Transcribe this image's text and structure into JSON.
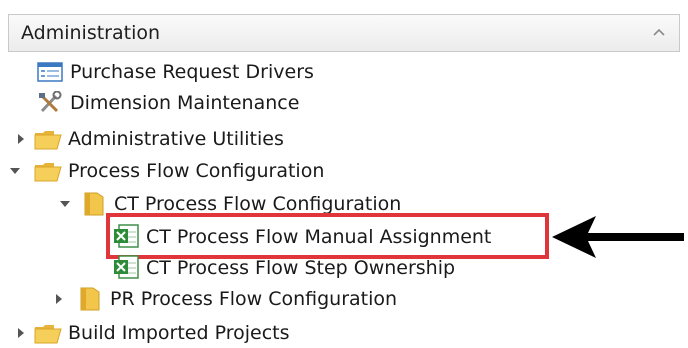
{
  "panel": {
    "title": "Administration"
  },
  "tree": {
    "purchase_request_drivers": "Purchase Request Drivers",
    "dimension_maintenance": "Dimension Maintenance",
    "administrative_utilities": "Administrative Utilities",
    "process_flow_configuration": "Process Flow Configuration",
    "ct_process_flow_configuration": "CT Process Flow Configuration",
    "ct_process_flow_manual_assignment": "CT Process Flow Manual Assignment",
    "ct_process_flow_step_ownership": "CT Process Flow Step Ownership",
    "pr_process_flow_configuration": "PR Process Flow Configuration",
    "build_imported_projects": "Build Imported Projects"
  },
  "colors": {
    "highlight_border": "#e0353b",
    "folder_yellow": "#f2c64a",
    "excel_green": "#2e8b3a",
    "annotation_arrow": "#000000"
  },
  "icons": {
    "list": "list-doc-icon",
    "tools": "tools-icon",
    "folder_open": "folder-open-icon",
    "folder": "folder-icon",
    "excel": "excel-sheet-icon"
  }
}
